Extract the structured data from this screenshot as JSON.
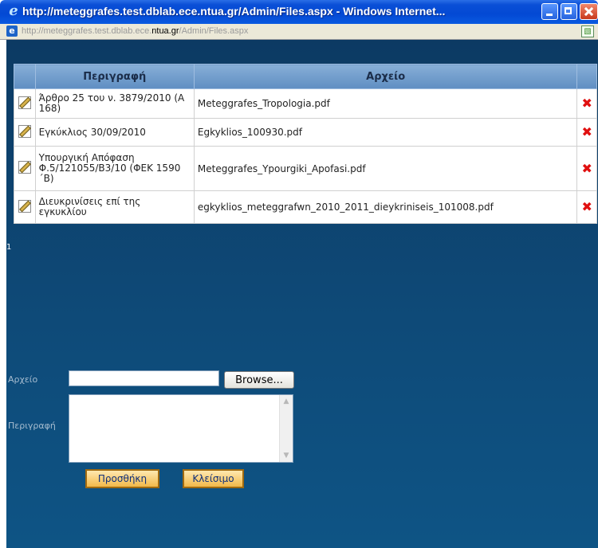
{
  "window": {
    "title": "http://meteggrafes.test.dblab.ece.ntua.gr/Admin/Files.aspx - Windows Internet...",
    "url_pre": "http://meteggrafes.test.dblab.ece.",
    "url_host": "ntua.gr",
    "url_post": "/Admin/Files.aspx"
  },
  "grid": {
    "headers": [
      "",
      "Περιγραφή",
      "Αρχείο",
      ""
    ],
    "rows": [
      {
        "desc": "Άρθρο 25 του ν. 3879/2010 (Α 168)",
        "file": "Meteggrafes_Tropologia.pdf"
      },
      {
        "desc": "Εγκύκλιος 30/09/2010",
        "file": "Egkyklios_100930.pdf"
      },
      {
        "desc": "Υπουργική Απόφαση Φ.5/121055/Β3/10 (ΦΕΚ 1590 ΄Β)",
        "file": "Meteggrafes_Ypourgiki_Apofasi.pdf"
      },
      {
        "desc": "Διευκρινίσεις επί της εγκυκλίου",
        "file": "egkyklios_meteggrafwn_2010_2011_dieykriniseis_101008.pdf"
      }
    ],
    "delete_glyph": "✖"
  },
  "pager": "1",
  "form": {
    "file_label": "Αρχείο",
    "desc_label": "Περιγραφή",
    "browse_label": "Browse...",
    "add_label": "Προσθήκη",
    "close_label": "Κλείσιμο"
  },
  "colors": {
    "accent": "#0c3a63",
    "delete": "#e01010",
    "button": "#f2b94a"
  },
  "icons": [
    "ie-logo-icon",
    "minimize-icon",
    "maximize-icon",
    "close-icon",
    "page-icon",
    "certificate-icon",
    "edit-icon",
    "delete-icon"
  ]
}
